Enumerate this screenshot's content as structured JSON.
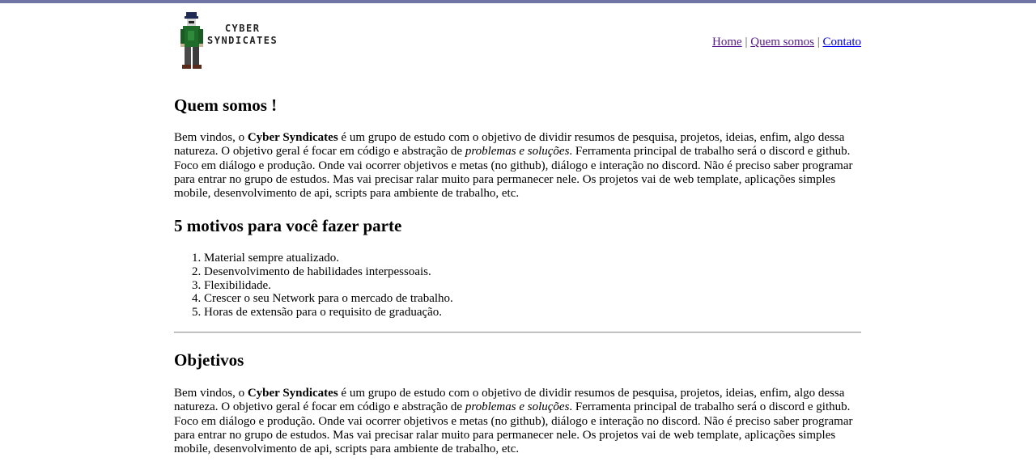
{
  "header": {
    "logo_line1": "CYBER",
    "logo_line2": "SYNDICATES",
    "nav": [
      {
        "label": "Home"
      },
      {
        "label": "Quem somos"
      },
      {
        "label": "Contato"
      }
    ],
    "separator": "|"
  },
  "sections": {
    "quem_somos": {
      "title": "Quem somos !",
      "p_before_bold": "Bem vindos, o ",
      "p_bold": "Cyber Syndicates",
      "p_middle": " é um grupo de estudo com o objetivo de dividir resumos de pesquisa, projetos, ideias, enfim, algo dessa natureza. O objetivo geral é focar em código e abstração de ",
      "p_italic": "problemas e soluções",
      "p_after": ". Ferramenta principal de trabalho será o discord e github. Foco em diálogo e produção. Onde vai ocorrer objetivos e metas (no github), diálogo e interação no discord. Não é preciso saber programar para entrar no grupo de estudos. Mas vai precisar ralar muito para permanecer nele. Os projetos vai de web template, aplicações simples mobile, desenvolvimento de api, scripts para ambiente de trabalho, etc."
    },
    "motivos": {
      "title": "5 motivos para você fazer parte",
      "items": [
        "Material sempre atualizado.",
        "Desenvolvimento de habilidades interpessoais.",
        "Flexibilidade.",
        "Crescer o seu Network para o mercado de trabalho.",
        "Horas de extensão para o requisito de graduação."
      ]
    },
    "objetivos": {
      "title": "Objetivos",
      "p_before_bold": "Bem vindos, o ",
      "p_bold": "Cyber Syndicates",
      "p_middle": " é um grupo de estudo com o objetivo de dividir resumos de pesquisa, projetos, ideias, enfim, algo dessa natureza. O objetivo geral é focar em código e abstração de ",
      "p_italic": "problemas e soluções",
      "p_after": ". Ferramenta principal de trabalho será o discord e github. Foco em diálogo e produção. Onde vai ocorrer objetivos e metas (no github), diálogo e interação no discord. Não é preciso saber programar para entrar no grupo de estudos. Mas vai precisar ralar muito para permanecer nele. Os projetos vai de web template, aplicações simples mobile, desenvolvimento de api, scripts para ambiente de trabalho, etc."
    }
  },
  "colors": {
    "topbar": "#6f74a5",
    "visited_link": "#551a8b",
    "link": "#0000ee"
  }
}
